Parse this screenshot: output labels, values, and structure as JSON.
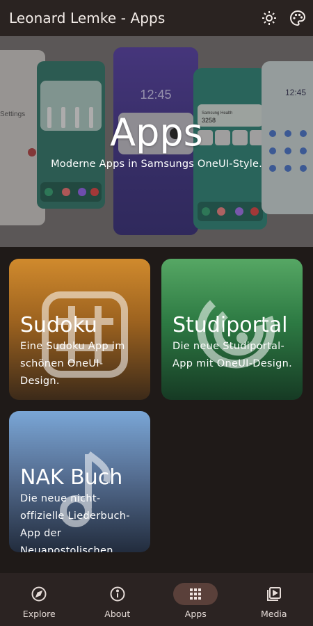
{
  "app_bar": {
    "title": "Leonard Lemke - Apps",
    "actions": [
      "brightness-icon",
      "palette-icon"
    ]
  },
  "hero": {
    "title": "Apps",
    "subtitle": "Moderne Apps in Samsungs OneUI-Style.",
    "phone_texts": {
      "settings": "Settings",
      "clock_left": "12:45",
      "clock_right": "12:45",
      "steps_label": "Samsung Health",
      "steps_value": "3258"
    }
  },
  "cards": [
    {
      "title": "Sudoku",
      "description": "Eine Sudoku App im schönen OneUI-Design.",
      "icon": "sudoku-grid-icon"
    },
    {
      "title": "Studiportal",
      "description": "Die neue Studiportal-App mit OneUI-Design.",
      "icon": "studiportal-logo-icon"
    },
    {
      "title": "NAK Buch",
      "description": "Die neue nicht-offizielle Liederbuch-App der Neuapostolischen Kirche.",
      "icon": "music-note-icon"
    }
  ],
  "nav": {
    "items": [
      {
        "label": "Explore",
        "icon": "compass-icon",
        "active": false
      },
      {
        "label": "About",
        "icon": "info-icon",
        "active": false
      },
      {
        "label": "Apps",
        "icon": "apps-grid-icon",
        "active": true
      },
      {
        "label": "Media",
        "icon": "media-icon",
        "active": false
      }
    ]
  },
  "colors": {
    "background": "#1f1a18",
    "app_bar": "#2a2321",
    "nav_bar": "#2b2322",
    "nav_active_pill": "#5a403a",
    "sudoku_card": "#d08a2d",
    "studiportal_card": "#56a764",
    "nak_card": "#7aa6d6"
  }
}
